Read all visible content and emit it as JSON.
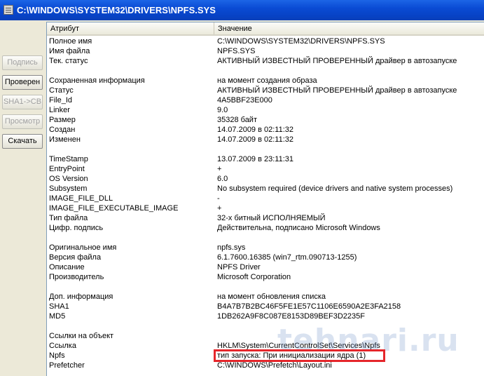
{
  "window": {
    "title": "C:\\WINDOWS\\SYSTEM32\\DRIVERS\\NPFS.SYS",
    "icon": "window-icon"
  },
  "buttons": [
    {
      "label": "Подпись",
      "enabled": false
    },
    {
      "label": "Проверен",
      "enabled": true
    },
    {
      "label": "SHA1->CB",
      "enabled": false
    },
    {
      "label": "Просмотр",
      "enabled": false
    },
    {
      "label": "Скачать",
      "enabled": true
    }
  ],
  "table": {
    "columns": [
      "Атрибут",
      "Значение"
    ],
    "rows": [
      [
        "Полное имя",
        "C:\\WINDOWS\\SYSTEM32\\DRIVERS\\NPFS.SYS"
      ],
      [
        "Имя файла",
        "NPFS.SYS"
      ],
      [
        "Тек. статус",
        "АКТИВНЫЙ ИЗВЕСТНЫЙ ПРОВЕРЕННЫЙ драйвер в автозапуске"
      ],
      [
        "",
        ""
      ],
      [
        "Сохраненная информация",
        "на момент создания образа"
      ],
      [
        "Статус",
        "АКТИВНЫЙ ИЗВЕСТНЫЙ ПРОВЕРЕННЫЙ драйвер в автозапуске"
      ],
      [
        "File_Id",
        "4A5BBF23E000"
      ],
      [
        "Linker",
        "9.0"
      ],
      [
        "Размер",
        "35328 байт"
      ],
      [
        "Создан",
        "14.07.2009 в 02:11:32"
      ],
      [
        "Изменен",
        "14.07.2009 в 02:11:32"
      ],
      [
        "",
        ""
      ],
      [
        "TimeStamp",
        "13.07.2009 в 23:11:31"
      ],
      [
        "EntryPoint",
        "+"
      ],
      [
        "OS Version",
        "6.0"
      ],
      [
        "Subsystem",
        "No subsystem required (device drivers and native system processes)"
      ],
      [
        "IMAGE_FILE_DLL",
        "-"
      ],
      [
        "IMAGE_FILE_EXECUTABLE_IMAGE",
        "+"
      ],
      [
        "Тип файла",
        "32-х битный ИСПОЛНЯЕМЫЙ"
      ],
      [
        "Цифр. подпись",
        "Действительна, подписано Microsoft Windows"
      ],
      [
        "",
        ""
      ],
      [
        "Оригинальное имя",
        "npfs.sys"
      ],
      [
        "Версия файла",
        "6.1.7600.16385 (win7_rtm.090713-1255)"
      ],
      [
        "Описание",
        "NPFS Driver"
      ],
      [
        "Производитель",
        "Microsoft Corporation"
      ],
      [
        "",
        ""
      ],
      [
        "Доп. информация",
        "на момент обновления списка"
      ],
      [
        "SHA1",
        "B4A7B7B2BC46F5FE1E57C1106E6590A2E3FA2158"
      ],
      [
        "MD5",
        "1DB262A9F8C087E8153D89BEF3D2235F"
      ],
      [
        "",
        ""
      ],
      [
        "Ссылки на объект",
        ""
      ],
      [
        "Ссылка",
        "HKLM\\System\\CurrentControlSet\\Services\\Npfs"
      ],
      [
        "Npfs",
        "тип запуска: При инициализации ядра (1)"
      ],
      [
        "Prefetcher",
        "C:\\WINDOWS\\Prefetch\\Layout.ini"
      ]
    ]
  },
  "watermark": "tehnari.ru",
  "highlight_color": "#e5262b"
}
